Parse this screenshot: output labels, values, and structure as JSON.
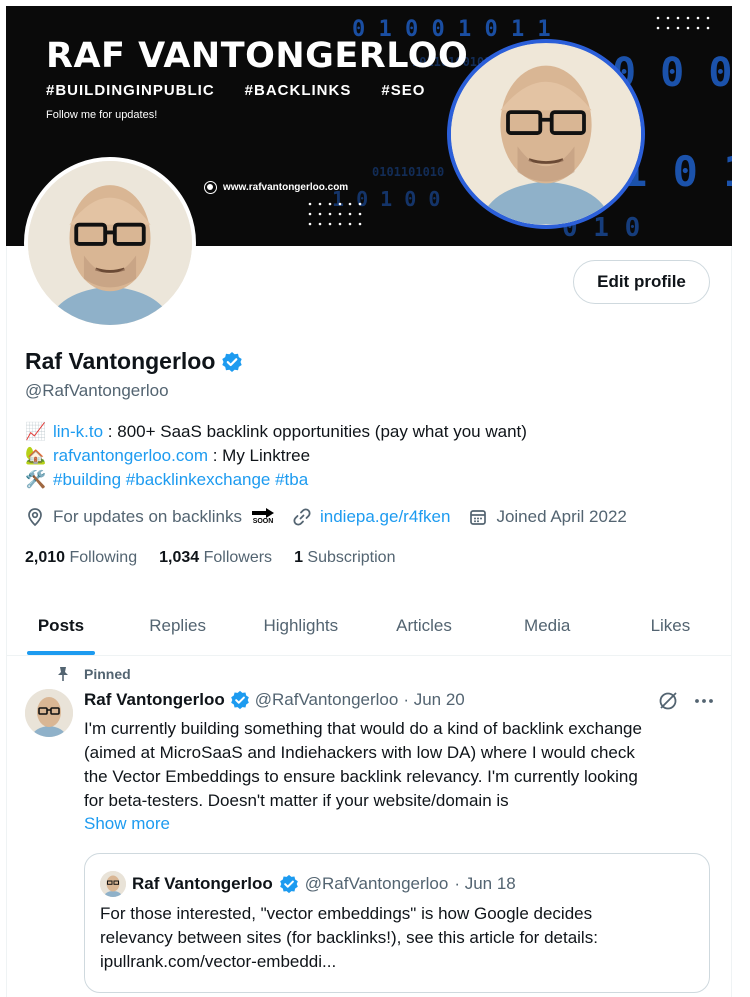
{
  "banner": {
    "title": "RAF VANTONGERLOO",
    "tags": [
      "#BUILDINGINPUBLIC",
      "#BACKLINKS",
      "#SEO"
    ],
    "follow_text": "Follow me for updates!",
    "website": "www.rafvantongerloo.com"
  },
  "profile": {
    "display_name": "Raf Vantongerloo",
    "handle": "@RafVantongerloo",
    "edit_button": "Edit profile",
    "verified_color": "#1d9bf0",
    "bio": {
      "line1_emoji": "📈",
      "line1_link": "lin-k.to",
      "line1_text": " : 800+ SaaS backlink opportunities (pay what you want)",
      "line2_emoji": "🏡",
      "line2_link": "rafvantongerloo.com",
      "line2_text": " : My Linktree",
      "line3_emoji": "🛠️",
      "line3_tags": "#building #backlinkexchange #tba"
    },
    "location": "For updates on backlinks",
    "location_badge": "SOON",
    "url": "indiepa.ge/r4fken",
    "joined": "Joined April 2022",
    "stats": {
      "following_count": "2,010",
      "following_label": "Following",
      "followers_count": "1,034",
      "followers_label": "Followers",
      "subscription_count": "1",
      "subscription_label": "Subscription"
    }
  },
  "tabs": [
    "Posts",
    "Replies",
    "Highlights",
    "Articles",
    "Media",
    "Likes"
  ],
  "pinned_tweet": {
    "pinned_label": "Pinned",
    "author": "Raf Vantongerloo",
    "handle": "@RafVantongerloo",
    "date": "· Jun 20",
    "body_lines": [
      "I'm currently building something that would do a kind of backlink exchange",
      "(aimed at MicroSaaS and Indiehackers with low DA) where I would check",
      "the Vector Embeddings to ensure backlink relevancy. I'm currently looking",
      "for beta-testers. Doesn't matter if your website/domain is"
    ],
    "show_more": "Show more",
    "quote": {
      "author": "Raf Vantongerloo",
      "handle": "@RafVantongerloo",
      "date": "· Jun 18",
      "body_lines": [
        "For those interested, \"vector embeddings\" is how Google decides",
        "relevancy between sites (for backlinks!), see this article for details:",
        "ipullrank.com/vector-embeddi..."
      ]
    }
  },
  "colors": {
    "accent": "#1d9bf0",
    "muted_text": "#536471",
    "banner_ring": "#2b5fd9"
  }
}
